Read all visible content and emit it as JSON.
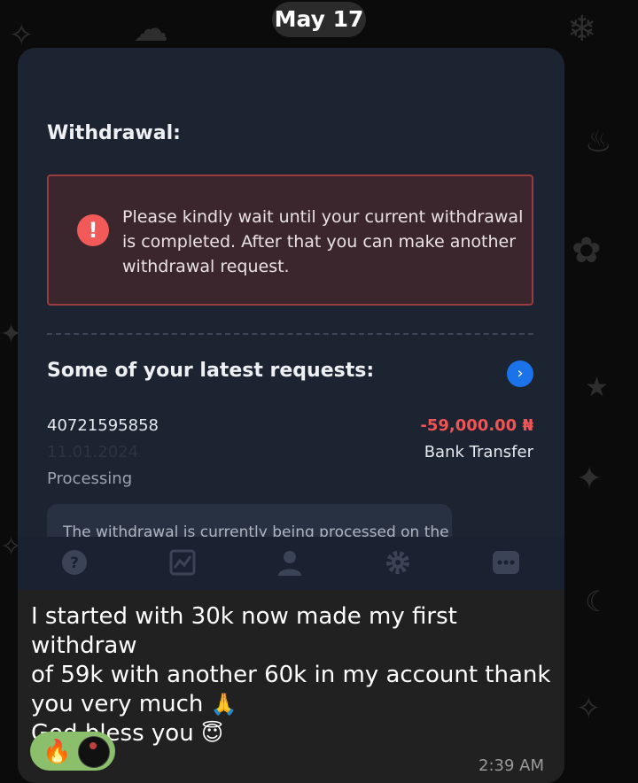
{
  "chat": {
    "date_label": "May 17",
    "message_lines": [
      "I started with 30k now made my first withdraw",
      "of 59k with another 60k in my account thank",
      "you very much",
      "God bless you"
    ],
    "time": "2:39 AM",
    "reaction_emoji": "🔥",
    "emojis": {
      "pray": "🙏",
      "angel": "😇"
    }
  },
  "screenshot": {
    "withdrawal_title": "Withdrawal:",
    "alert_icon_glyph": "!",
    "alert_text": "Please kindly wait until your current withdrawal is completed. After that you can make another withdrawal request.",
    "requests_title": "Some of your latest requests:",
    "arrow_glyph": "›",
    "request": {
      "id": "40721595858",
      "date": "11.01.2024",
      "status": "Processing",
      "amount": "-59,000.00 ₦",
      "method": "Bank Transfer"
    },
    "info_text": "The withdrawal is currently being processed on the",
    "tabs": [
      {
        "icon": "help-icon"
      },
      {
        "icon": "chart-icon"
      },
      {
        "icon": "user-icon"
      },
      {
        "icon": "gear-icon"
      },
      {
        "icon": "chat-icon"
      }
    ]
  },
  "colors": {
    "app_background": "#1c2331",
    "alert_background": "#3c262d",
    "alert_border": "#9a3b3d",
    "amount": "#f05454",
    "accent_blue": "#1a73e8",
    "reaction_background": "#8cbf6b"
  }
}
